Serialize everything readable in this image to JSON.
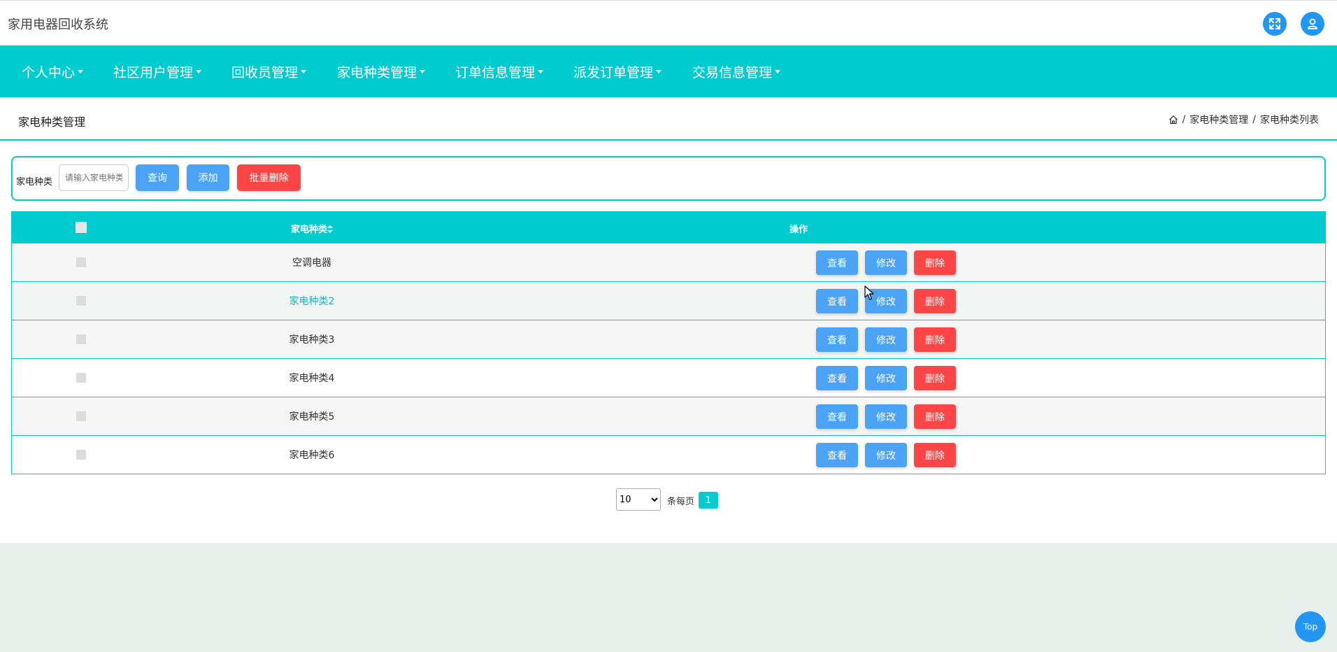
{
  "app": {
    "title": "家用电器回收系统"
  },
  "header": {
    "fullscreen_icon": "expand-icon",
    "user_icon": "user-icon"
  },
  "nav": {
    "items": [
      {
        "label": "个人中心"
      },
      {
        "label": "社区用户管理"
      },
      {
        "label": "回收员管理"
      },
      {
        "label": "家电种类管理"
      },
      {
        "label": "订单信息管理"
      },
      {
        "label": "派发订单管理"
      },
      {
        "label": "交易信息管理"
      }
    ]
  },
  "page": {
    "title": "家电种类管理",
    "breadcrumb": {
      "home_icon": "home-icon",
      "level1": "家电种类管理",
      "level2": "家电种类列表",
      "separator": "/"
    }
  },
  "search": {
    "label": "家电种类",
    "placeholder": "请输入家电种类",
    "query_label": "查询",
    "add_label": "添加",
    "batch_delete_label": "批量删除"
  },
  "table": {
    "headers": {
      "name": "家电种类",
      "sort_icon": "sort-icon",
      "actions": "操作"
    },
    "rows": [
      {
        "name": "空调电器"
      },
      {
        "name": "家电种类2"
      },
      {
        "name": "家电种类3"
      },
      {
        "name": "家电种类4"
      },
      {
        "name": "家电种类5"
      },
      {
        "name": "家电种类6"
      }
    ],
    "actions": {
      "view": "查看",
      "edit": "修改",
      "delete": "删除"
    }
  },
  "pagination": {
    "page_size": "10",
    "page_size_options": [
      "10"
    ],
    "per_page_label": "条每页",
    "current_page": "1"
  },
  "back_to_top": {
    "label": "Top"
  },
  "colors": {
    "accent": "#00ccd0",
    "primary_button": "#4aa3f5",
    "danger_button": "#ff4545",
    "hover_link": "#17b6c2"
  }
}
